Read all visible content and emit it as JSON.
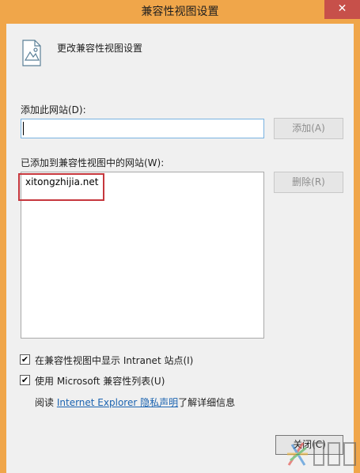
{
  "window": {
    "title": "兼容性视图设置",
    "close_glyph": "✕"
  },
  "header": {
    "text": "更改兼容性视图设置",
    "icon": "document-icon"
  },
  "add_site": {
    "label": "添加此网站(D):",
    "value": "",
    "button_label": "添加(A)"
  },
  "sites": {
    "label": "已添加到兼容性视图中的网站(W):",
    "items": [
      "xitongzhijia.net"
    ],
    "remove_label": "删除(R)"
  },
  "options": {
    "intranet_label": "在兼容性视图中显示 Intranet 站点(I)",
    "intranet_checked": "✔",
    "ms_list_label": "使用 Microsoft 兼容性列表(U)",
    "ms_list_checked": "✔"
  },
  "info": {
    "prefix": "阅读",
    "link": "Internet Explorer 隐私声明",
    "suffix": "了解详细信息"
  },
  "footer": {
    "close_label": "关闭(C)"
  },
  "colors": {
    "titlebar": "#f0a64a",
    "close": "#c7504a",
    "highlight": "#c6373d",
    "link": "#1b63b0"
  }
}
